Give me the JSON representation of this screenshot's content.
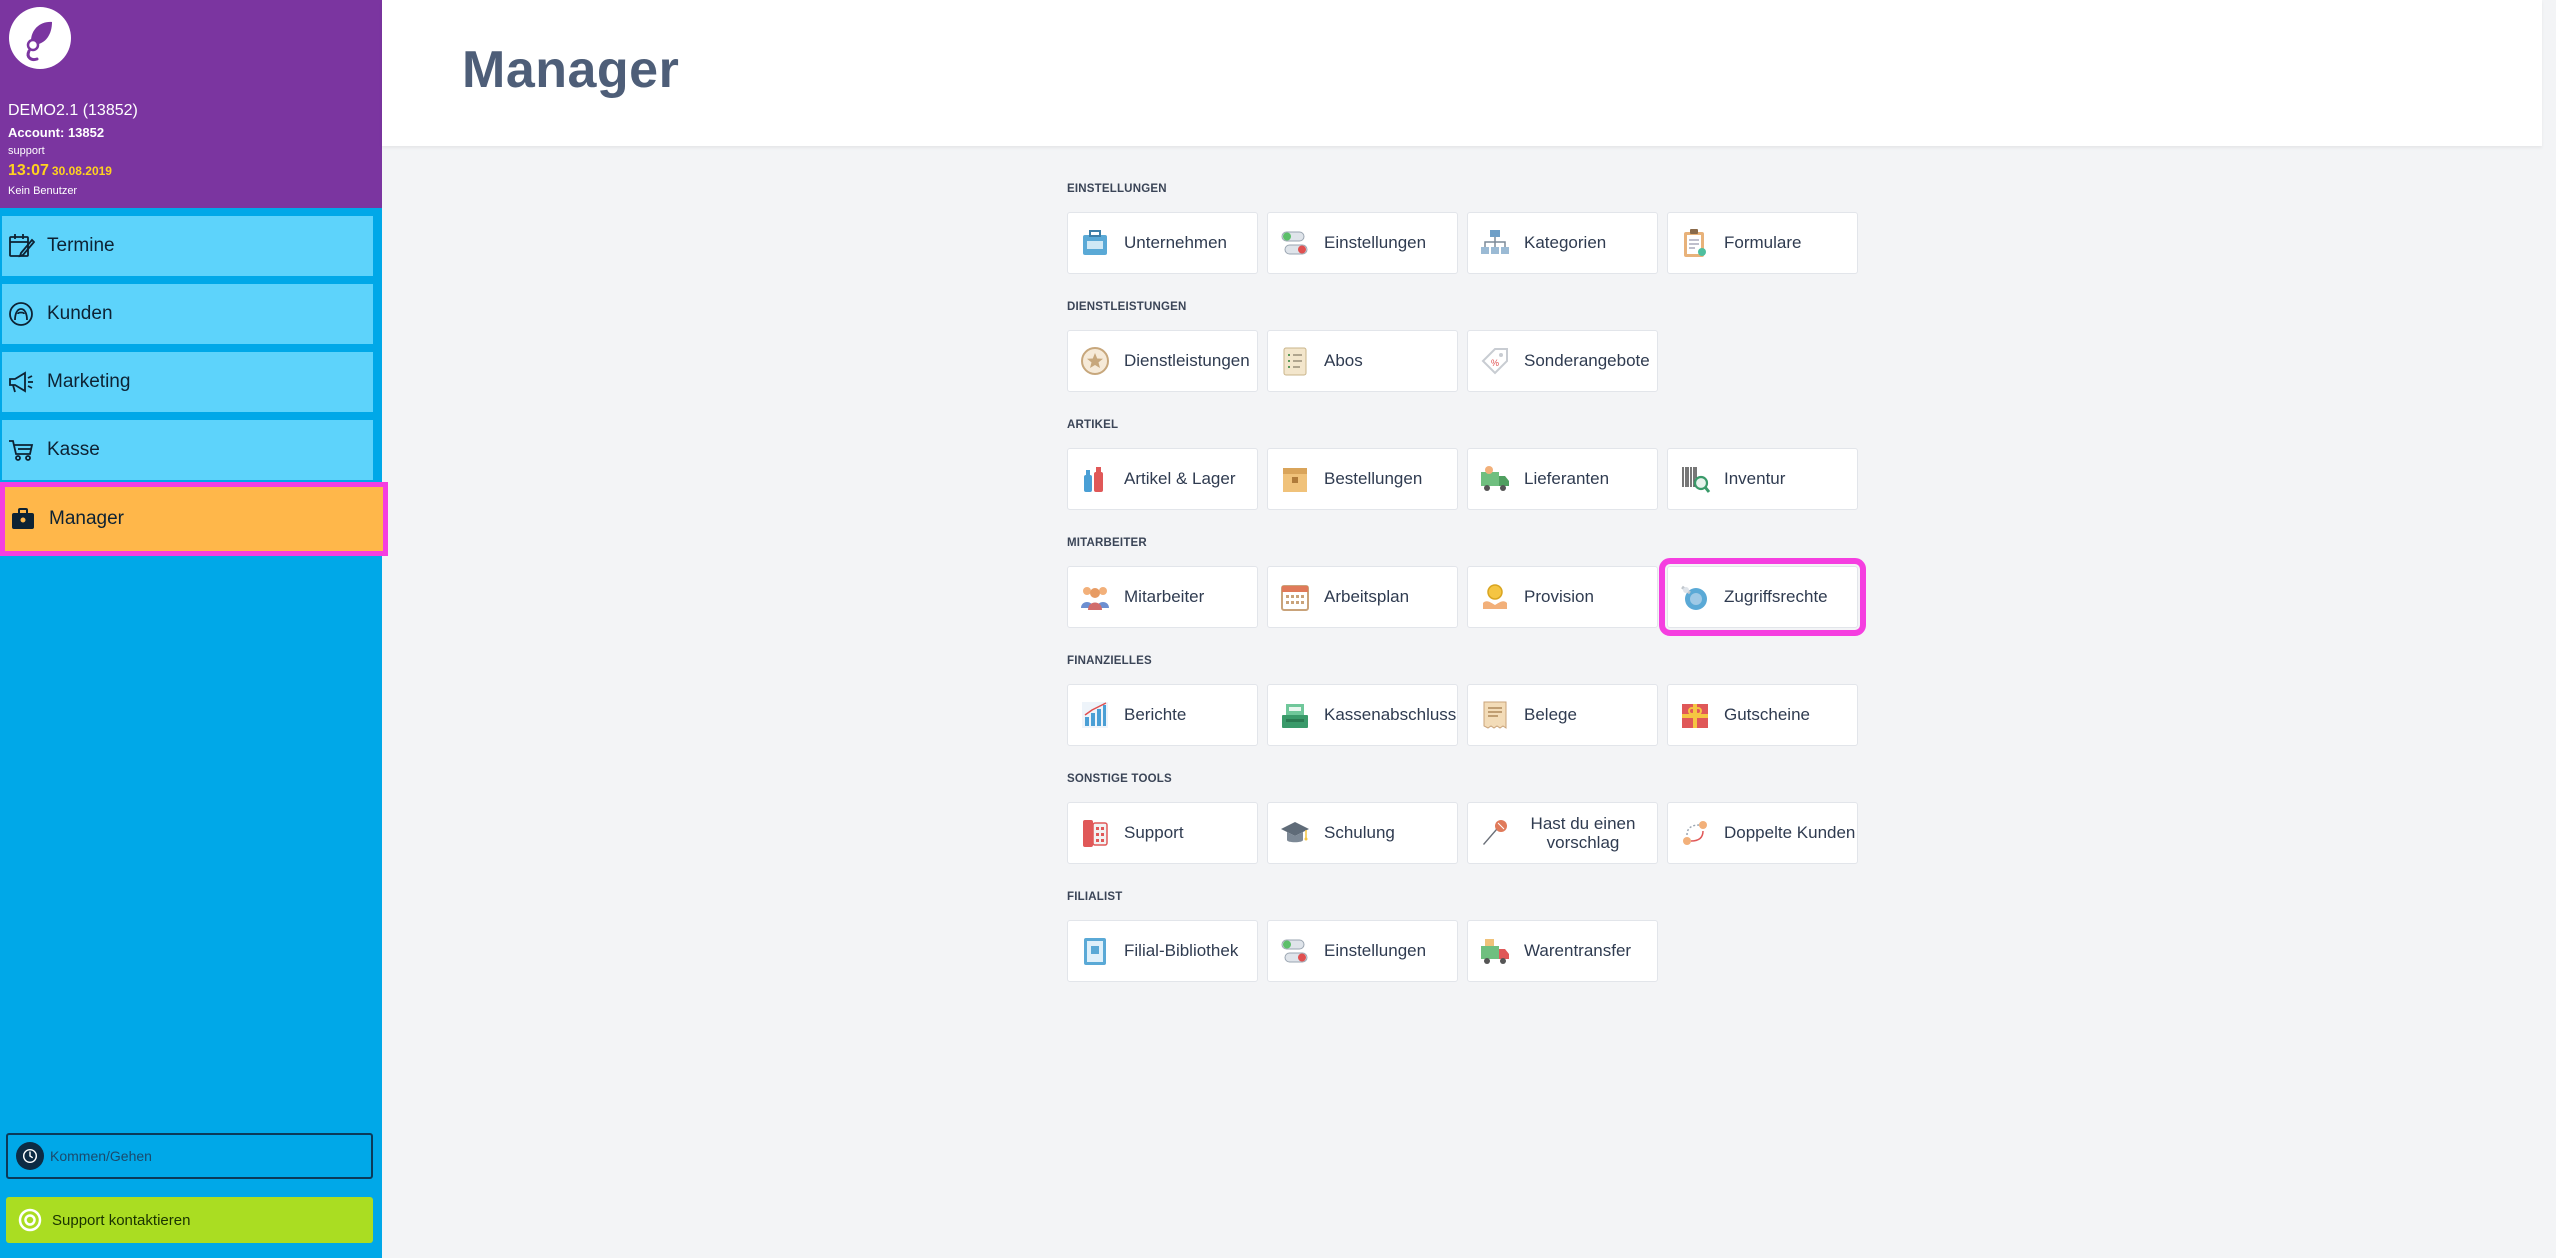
{
  "sidebar": {
    "account_name": "DEMO2.1 (13852)",
    "account_line": "Account: 13852",
    "support_user": "support",
    "time": "13:07",
    "date": "30.08.2019",
    "user_status": "Kein Benutzer",
    "nav": [
      {
        "label": "Termine",
        "icon": "calendar-pen-icon"
      },
      {
        "label": "Kunden",
        "icon": "customer-icon"
      },
      {
        "label": "Marketing",
        "icon": "megaphone-icon"
      },
      {
        "label": "Kasse",
        "icon": "cart-icon"
      },
      {
        "label": "Manager",
        "icon": "briefcase-icon",
        "active": true
      }
    ],
    "kommen_gehen": "Kommen/Gehen",
    "support_contact": "Support kontaktieren"
  },
  "main": {
    "title": "Manager",
    "sections": [
      {
        "title": "EINSTELLUNGEN",
        "tiles": [
          {
            "label": "Unternehmen",
            "icon": "company-icon"
          },
          {
            "label": "Einstellungen",
            "icon": "toggles-icon"
          },
          {
            "label": "Kategorien",
            "icon": "hierarchy-icon"
          },
          {
            "label": "Formulare",
            "icon": "clipboard-icon"
          }
        ]
      },
      {
        "title": "DIENSTLEISTUNGEN",
        "tiles": [
          {
            "label": "Dienstleistungen",
            "icon": "star-badge-icon"
          },
          {
            "label": "Abos",
            "icon": "checklist-icon"
          },
          {
            "label": "Sonderangebote",
            "icon": "price-tag-icon"
          }
        ]
      },
      {
        "title": "ARTIKEL",
        "tiles": [
          {
            "label": "Artikel & Lager",
            "icon": "bottles-icon"
          },
          {
            "label": "Bestellungen",
            "icon": "box-icon"
          },
          {
            "label": "Lieferanten",
            "icon": "delivery-truck-icon"
          },
          {
            "label": "Inventur",
            "icon": "barcode-search-icon"
          }
        ]
      },
      {
        "title": "MITARBEITER",
        "tiles": [
          {
            "label": "Mitarbeiter",
            "icon": "team-icon"
          },
          {
            "label": "Arbeitsplan",
            "icon": "calendar-grid-icon"
          },
          {
            "label": "Provision",
            "icon": "coin-hand-icon"
          },
          {
            "label": "Zugriffsrechte",
            "icon": "key-lock-icon",
            "highlight": true
          }
        ]
      },
      {
        "title": "FINANZIELLES",
        "tiles": [
          {
            "label": "Berichte",
            "icon": "bar-chart-icon"
          },
          {
            "label": "Kassenabschluss",
            "icon": "cash-register-icon"
          },
          {
            "label": "Belege",
            "icon": "receipt-icon"
          },
          {
            "label": "Gutscheine",
            "icon": "gift-voucher-icon"
          }
        ]
      },
      {
        "title": "SONSTIGE TOOLS",
        "tiles": [
          {
            "label": "Support",
            "icon": "phone-icon"
          },
          {
            "label": "Schulung",
            "icon": "graduation-cap-icon"
          },
          {
            "label": "Hast du einen vorschlag",
            "icon": "microphone-icon"
          },
          {
            "label": "Doppelte Kunden",
            "icon": "duplicate-users-icon"
          }
        ]
      },
      {
        "title": "FILIALIST",
        "tiles": [
          {
            "label": "Filial-Bibliothek",
            "icon": "library-icon"
          },
          {
            "label": "Einstellungen",
            "icon": "toggles-icon"
          },
          {
            "label": "Warentransfer",
            "icon": "transfer-truck-icon"
          }
        ]
      }
    ]
  },
  "colors": {
    "sidebar_header": "#7b35a0",
    "sidebar_bg": "#00a8e8",
    "nav_item": "#5dd3fb",
    "nav_active": "#ffb74a",
    "highlight_border": "#f53ee0",
    "support_button": "#aadd22",
    "clock_text": "#ffd21f"
  }
}
